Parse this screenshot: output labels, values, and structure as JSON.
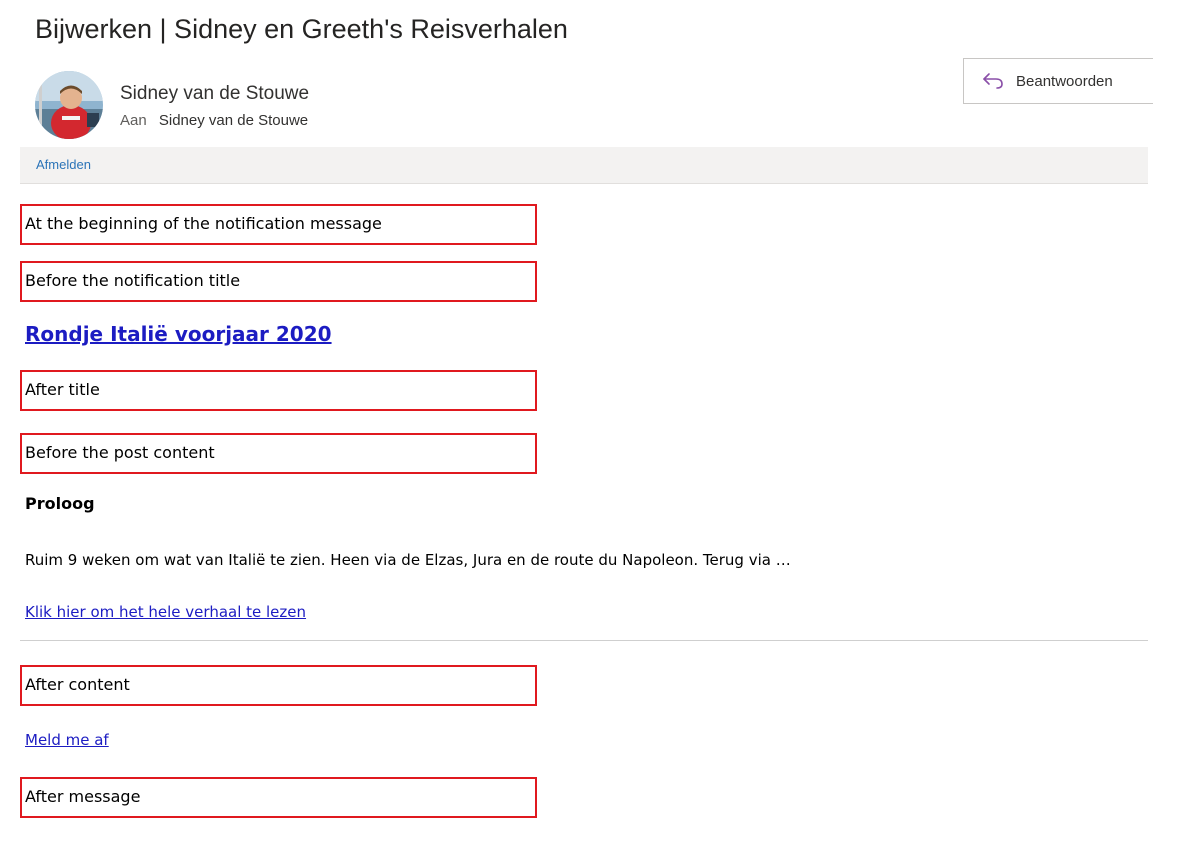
{
  "email": {
    "subject": "Bijwerken | Sidney en Greeth's Reisverhalen",
    "sender_name": "Sidney van de Stouwe",
    "to_label": "Aan",
    "to_name": "Sidney van de Stouwe",
    "reply_label": "Beantwoorden",
    "reply_icon": "reply-arrow-icon",
    "unsubscribe_bar_label": "Afmelden"
  },
  "body": {
    "box_start_message": "At the beginning of the notification message",
    "box_before_title": "Before the notification title",
    "post_title": "Rondje Italië voorjaar 2020",
    "box_after_title": "After title",
    "box_before_content": "Before the post content",
    "post_heading": "Proloog",
    "post_excerpt": "Ruim 9 weken om wat van Italië te zien. Heen via de Elzas, Jura en de route du Napoleon. Terug via …",
    "read_more_link": "Klik hier om het hele verhaal te lezen",
    "box_after_content": "After content",
    "unsubscribe_link": "Meld me af",
    "box_after_message": "After message"
  },
  "colors": {
    "link": "#1c1cc2",
    "box_border": "#e0191f",
    "unsubscribe_bar_bg": "#f3f2f1",
    "unsubscribe_bar_link": "#2b74b8",
    "reply_icon": "#8a4fa8"
  }
}
